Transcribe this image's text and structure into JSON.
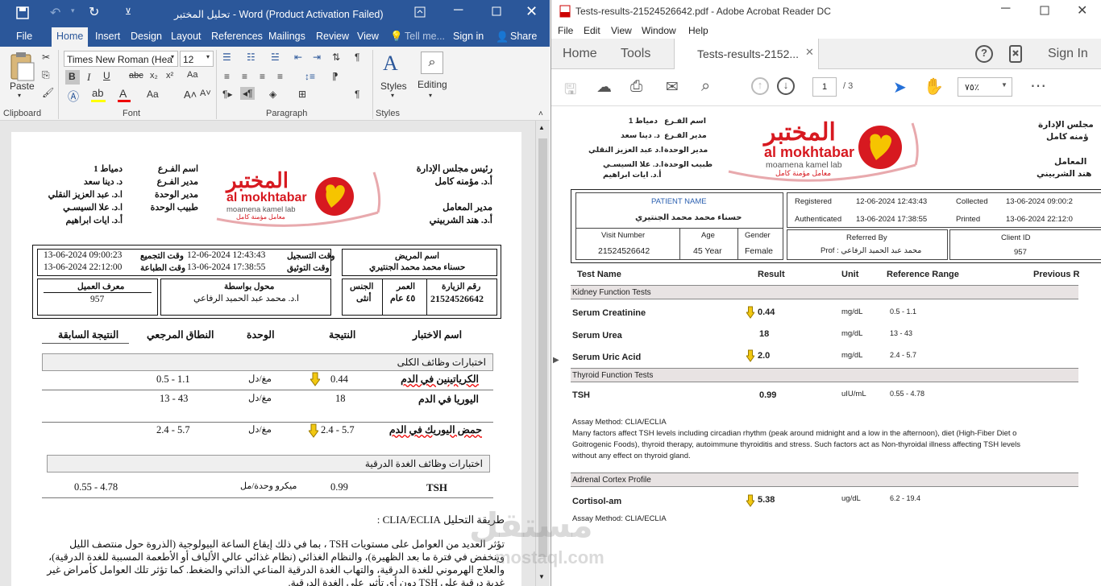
{
  "word": {
    "title": "تحليل المختبر - Word (Product Activation Failed)",
    "tabs": [
      "File",
      "Home",
      "Insert",
      "Design",
      "Layout",
      "References",
      "Mailings",
      "Review",
      "View"
    ],
    "tell_me": "Tell me...",
    "sign_in": "Sign in",
    "share": "Share",
    "font_name": "Times New Roman (Hea",
    "font_size": "12",
    "paste": "Paste",
    "styles": "Styles",
    "editing": "Editing",
    "groups": {
      "clipboard": "Clipboard",
      "font": "Font",
      "paragraph": "Paragraph",
      "styles": "Styles"
    },
    "doc": {
      "hdr_left": {
        "l1": "رئيس مجلس الإدارة",
        "l2": "أ.د. مؤمنه كامل",
        "l3": "مدير المعامل",
        "l4": "أ.د. هند الشربيني"
      },
      "hdr_right": {
        "labels": [
          "اسم الفـرع",
          "مدير الفـرع",
          "مدير الوحدة",
          "طبيب الوحدة"
        ],
        "values": [
          "دمياط 1",
          "د. دينا سعد",
          "ا.د. عبد العزيز النقلي",
          "ا.د. علا السيسـي"
        ],
        "extra": "أ.د. ايات ابراهيم"
      },
      "logo_ar": "المختبر",
      "logo_en": "al mokhtabar",
      "logo_sub": "moamena kamel lab",
      "logo_sub_ar": "معامل مؤمنة كامل",
      "patient_label": "اسم المريض",
      "patient_name": "حسناء محمد محمد الجنتيري",
      "reg_label": "وقت التسجيل",
      "reg_value": "12-06-2024 12:43:43",
      "collect_label": "وقت التجميع",
      "collect_value": "13-06-2024 09:00:23",
      "auth_label": "وقت التوثيق",
      "auth_value": "13-06-2024 17:38:55",
      "print_label": "وقت الطباعة",
      "print_value": "13-06-2024 22:12:00",
      "visit_label": "رقم الزيارة",
      "visit_value": "21524526642",
      "age_label": "العمر",
      "age_value": "٤٥ عام",
      "gender_label": "الجنس",
      "gender_value": "أنثى",
      "ref_label": "محول بواسطة",
      "ref_value": "ا.د. محمد عبد الحميد الرفاعي",
      "client_label": "معرف العميل",
      "client_value": "957",
      "col_test": "اسم الاختبار",
      "col_result": "النتيجة",
      "col_unit": "الوحدة",
      "col_range": "النطاق المرجعي",
      "col_prev": "النتيجة السابقة",
      "sec_kidney": "اختبارات وظائف الكلى",
      "sec_thyroid": "اختبارات وظائف الغدة الدرقية",
      "rows": [
        {
          "name": "الكرياتينين في الدم",
          "result": "0.44",
          "unit": "مغ/دل",
          "range": "0.5 - 1.1"
        },
        {
          "name": "اليوريا في الدم",
          "result": "18",
          "unit": "مغ/دل",
          "range": "13 - 43"
        },
        {
          "name": "حمض اليوريك في الدم",
          "result": "2.4 - 5.7",
          "unit": "مغ/دل",
          "range": "2.4 - 5.7"
        },
        {
          "name": "TSH",
          "result": "0.99",
          "unit": "ميكرو وحدة/مل",
          "range": "0.55 - 4.78"
        }
      ],
      "method": "طريقة التحليل CLIA/ECLIA :",
      "para1": "تؤثر العديد من العوامل على مستويات TSH ، بما في ذلك إيقاع الساعة البيولوجية (الذروة حول منتصف الليل",
      "para2": "وينخفض في فترة ما بعد الظهيرة)، والنظام الغذائي (نظام غذائي عالي الألياف أو الأطعمة المسببة للغدة الدرقية)،",
      "para3": "والعلاج الهرموني للغدة الدرقية، والتهاب الغدة الدرقية المناعي الذاتي والضغط. كما تؤثر تلك العوامل كأمراض غير",
      "para4": "غدية درقية على TSH دون أي تأثير على الغدة الدرقية."
    }
  },
  "acrobat": {
    "title": "Tests-results-21524526642.pdf - Adobe Acrobat Reader DC",
    "menu": [
      "File",
      "Edit",
      "View",
      "Window",
      "Help"
    ],
    "home": "Home",
    "tools": "Tools",
    "doc_tab": "Tests-results-2152...",
    "sign_in": "Sign In",
    "page_current": "1",
    "page_total": "/ 3",
    "zoom": "٧٥٪",
    "pdf": {
      "hdr_right": [
        "اسم الفـرع",
        "مدير الفـرع",
        "مدير الوحدة",
        "طبيب الوحدة"
      ],
      "hdr_right_vals": [
        "دمياط 1",
        "د. دينا سعد",
        "ا.د عبد العزيز النقلي",
        "ا.د. علا السيسـي"
      ],
      "hdr_right_extra": "أ.د. ايات ابراهيم",
      "hdr_left": [
        "مجلس الإدارة",
        "ؤمنه كامل",
        "المعامل",
        "هند الشربيني"
      ],
      "patient_label": "PATIENT NAME",
      "patient_name": "حسناء محمد محمد الجنتيري",
      "visit_label": "Visit Number",
      "visit_value": "21524526642",
      "age_label": "Age",
      "age_value": "45 Year",
      "gender_label": "Gender",
      "gender_value": "Female",
      "registered_label": "Registered",
      "registered_value": "12-06-2024 12:43:43",
      "collected_label": "Collected",
      "collected_value": "13-06-2024 09:00:2",
      "auth_label": "Authenticated",
      "auth_value": "13-06-2024 17:38:55",
      "printed_label": "Printed",
      "printed_value": "13-06-2024 22:12:0",
      "refby_label": "Referred By",
      "refby_value": "Prof : محمد عبد الحميد الرفاعي",
      "client_label": "Client ID",
      "client_value": "957",
      "col_test": "Test Name",
      "col_result": "Result",
      "col_unit": "Unit",
      "col_range": "Reference Range",
      "col_prev": "Previous R",
      "sec_kidney": "Kidney Function Tests",
      "sec_thyroid": "Thyroid Function Tests",
      "sec_adrenal": "Adrenal Cortex Profile",
      "rows": [
        {
          "name": "Serum Creatinine",
          "result": "0.44",
          "unit": "mg/dL",
          "range": "0.5 - 1.1"
        },
        {
          "name": "Serum Urea",
          "result": "18",
          "unit": "mg/dL",
          "range": "13 - 43"
        },
        {
          "name": "Serum Uric Acid",
          "result": "2.0",
          "unit": "mg/dL",
          "range": "2.4 - 5.7"
        },
        {
          "name": "TSH",
          "result": "0.99",
          "unit": "uIU/mL",
          "range": "0.55 - 4.78"
        },
        {
          "name": "Cortisol-am",
          "result": "5.38",
          "unit": "ug/dL",
          "range": "6.2 - 19.4"
        }
      ],
      "assay1": "Assay Method: CLIA/ECLIA",
      "note1": "Many factors affect TSH levels including circadian rhythm (peak around midnight and a low in the afternoon), diet (High-Fiber Diet o",
      "note2": "Goitrogenic Foods), thyroid therapy, autoimmune thyroiditis and stress. Such factors act as Non-thyroidal illness affecting TSH levels",
      "note3": "without any effect on thyroid gland.",
      "assay2": "Assay Method: CLIA/ECLIA"
    }
  },
  "watermark": {
    "ar": "مستقل",
    "en": "mostaql.com"
  },
  "colors": {
    "word_blue": "#2b579a",
    "logo_red": "#d71920",
    "logo_yellow": "#f6c400",
    "arrow_yellow": "#f2c811",
    "section_gray": "#e8e3e3"
  }
}
